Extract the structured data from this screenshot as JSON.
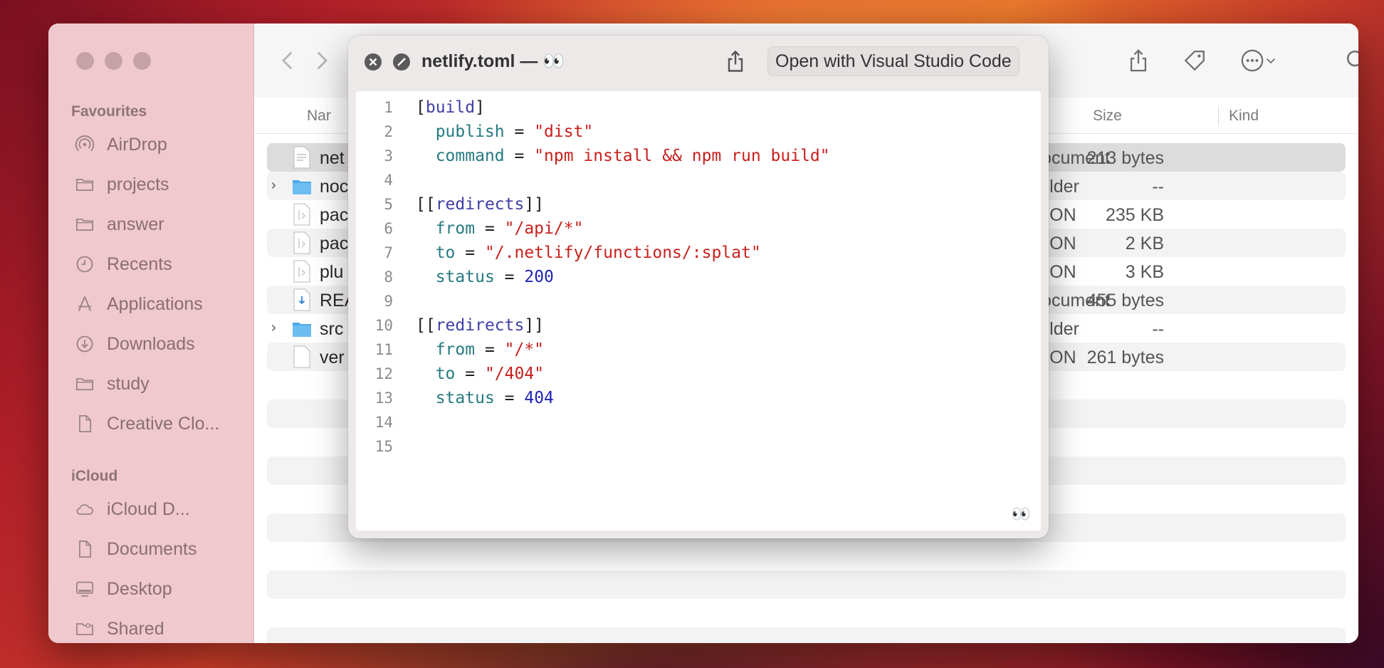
{
  "sidebar": {
    "favourites_heading": "Favourites",
    "favourites": [
      {
        "label": "AirDrop",
        "icon": "airdrop-icon"
      },
      {
        "label": "projects",
        "icon": "folder-icon"
      },
      {
        "label": "answer",
        "icon": "folder-icon"
      },
      {
        "label": "Recents",
        "icon": "clock-icon"
      },
      {
        "label": "Applications",
        "icon": "applications-icon"
      },
      {
        "label": "Downloads",
        "icon": "download-icon"
      },
      {
        "label": "study",
        "icon": "folder-icon"
      },
      {
        "label": "Creative Clo...",
        "icon": "document-icon"
      }
    ],
    "icloud_heading": "iCloud",
    "icloud": [
      {
        "label": "iCloud D...",
        "icon": "cloud-icon"
      },
      {
        "label": "Documents",
        "icon": "document-icon"
      },
      {
        "label": "Desktop",
        "icon": "desktop-icon"
      },
      {
        "label": "Shared",
        "icon": "shared-folder-icon"
      }
    ]
  },
  "columns": {
    "name": "Nar",
    "size": "Size",
    "kind": "Kind"
  },
  "files": [
    {
      "name": "net",
      "size": "213 bytes",
      "kind": "Document",
      "type": "text",
      "selected": true
    },
    {
      "name": "noc",
      "size": "--",
      "kind": "Folder",
      "type": "folder"
    },
    {
      "name": "pac",
      "size": "235 KB",
      "kind": "JSON",
      "type": "json"
    },
    {
      "name": "pac",
      "size": "2 KB",
      "kind": "JSON",
      "type": "json"
    },
    {
      "name": "plu",
      "size": "3 KB",
      "kind": "JSON",
      "type": "json"
    },
    {
      "name": "REA",
      "size": "455 bytes",
      "kind": "Document",
      "type": "markdown"
    },
    {
      "name": "src",
      "size": "--",
      "kind": "Folder",
      "type": "folder"
    },
    {
      "name": "ver",
      "size": "261 bytes",
      "kind": "JSON",
      "type": "blank"
    }
  ],
  "quicklook": {
    "title": "netlify.toml — 👀",
    "open_with_label": "Open with Visual Studio Code",
    "corner_badge": "👀",
    "lines": [
      {
        "n": "1",
        "src": "[build]"
      },
      {
        "n": "2",
        "src": "  publish = \"dist\""
      },
      {
        "n": "3",
        "src": "  command = \"npm install && npm run build\""
      },
      {
        "n": "4",
        "src": ""
      },
      {
        "n": "5",
        "src": "[[redirects]]"
      },
      {
        "n": "6",
        "src": "  from = \"/api/*\""
      },
      {
        "n": "7",
        "src": "  to = \"/.netlify/functions/:splat\""
      },
      {
        "n": "8",
        "src": "  status = 200"
      },
      {
        "n": "9",
        "src": ""
      },
      {
        "n": "10",
        "src": "[[redirects]]"
      },
      {
        "n": "11",
        "src": "  from = \"/*\""
      },
      {
        "n": "12",
        "src": "  to = \"/404\""
      },
      {
        "n": "13",
        "src": "  status = 404"
      },
      {
        "n": "14",
        "src": ""
      },
      {
        "n": "15",
        "src": ""
      }
    ]
  }
}
